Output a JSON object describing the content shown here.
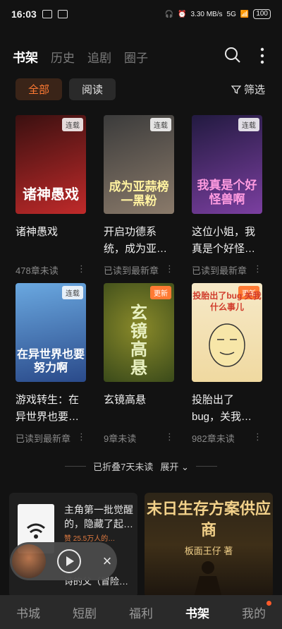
{
  "status": {
    "time": "16:03",
    "net_speed": "3.30 MB/s",
    "network": "5G",
    "battery": "100"
  },
  "header": {
    "tabs": [
      "书架",
      "历史",
      "追剧",
      "圈子"
    ]
  },
  "filters": {
    "all": "全部",
    "reading": "阅读",
    "screen": "筛选"
  },
  "books": [
    {
      "title": "诸神愚戏",
      "meta": "478章未读",
      "badge": "连载",
      "badge_type": "serial",
      "cover_text": "诸神愚戏",
      "colors": [
        "#3a1010",
        "#c02a2a"
      ]
    },
    {
      "title": "开启功德系统，成为亚…",
      "meta": "已读到最新章",
      "badge": "连载",
      "badge_type": "serial",
      "cover_text": "成为亚蒜榜一黑粉",
      "colors": [
        "#3b3b3b",
        "#8a7a6a"
      ]
    },
    {
      "title": "这位小姐，我真是个好怪…",
      "meta": "已读到最新章",
      "badge": "连载",
      "badge_type": "serial",
      "cover_text": "我真是个好怪兽啊",
      "colors": [
        "#221a40",
        "#7b3fa0"
      ]
    },
    {
      "title": "游戏转生：在异世界也要…",
      "meta": "已读到最新章",
      "badge": "连载",
      "badge_type": "serial",
      "cover_text": "在异世界也要努力啊",
      "colors": [
        "#6aa8e0",
        "#2a4a8a"
      ]
    },
    {
      "title": "玄镜高悬",
      "meta": "9章未读",
      "badge": "更新",
      "badge_type": "update",
      "cover_text": "玄镜高悬",
      "colors": [
        "#3a4a1a",
        "#8a8a2a"
      ]
    },
    {
      "title": "投胎出了bug，关我…",
      "meta": "982章未读",
      "badge": "更新",
      "badge_type": "update",
      "cover_text": "投胎出了bug 关我什么事儿",
      "colors": [
        "#f6e9c8",
        "#f0d9a0"
      ]
    }
  ],
  "folded": {
    "text": "已折叠7天未读",
    "expand": "展开"
  },
  "recommend": {
    "text": "主角第一批觉醒的，隐藏了起…",
    "sub": "赞 25.5万人的…",
    "bottom": "诗的父（冒险…"
  },
  "ad": {
    "title": "末日生存方案供应商",
    "author": "板面王仔 著"
  },
  "bottom_nav": [
    "书城",
    "短剧",
    "福利",
    "书架",
    "我的"
  ]
}
